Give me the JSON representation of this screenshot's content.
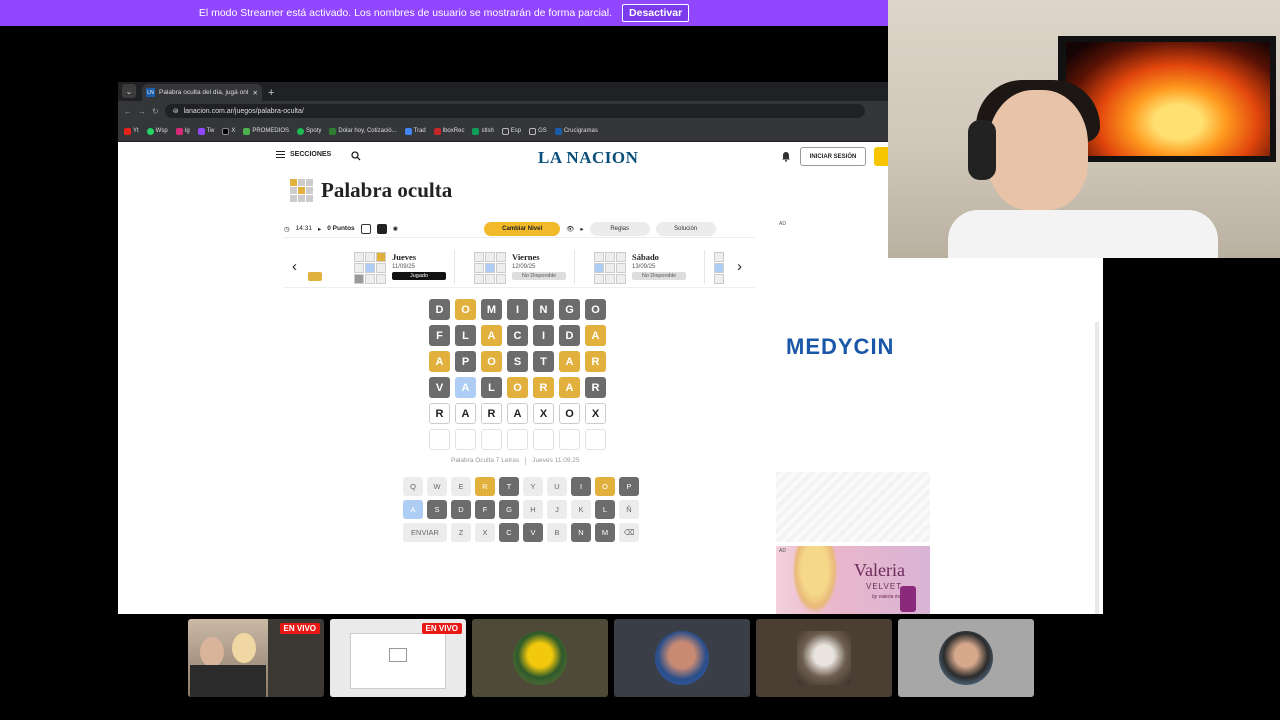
{
  "banner": {
    "text": "El modo Streamer está activado. Los nombres de usuario se mostrarán de forma parcial.",
    "button": "Desactivar"
  },
  "browser": {
    "tab_title": "Palabra oculta del día, jugá onl",
    "tab_favicon": "LN",
    "url": "lanacion.com.ar/juegos/palabra-oculta/",
    "bookmarks": [
      "Yt",
      "Wsp",
      "Ig",
      "Tw",
      "X",
      "PROMEDIOS",
      "Spoty",
      "Dolar hoy, Cotizació...",
      "Trad",
      "lboxRec",
      "stlsh",
      "Esp",
      "GS",
      "Crucigramas"
    ]
  },
  "site": {
    "sections": "SECCIONES",
    "logo": "LA NACION",
    "login": "INICIAR SESIÓN",
    "game_title": "Palabra oculta"
  },
  "toolbar": {
    "time": "14:31",
    "points": "0 Puntos",
    "level_button": "Cambiar Nivel",
    "rules": "Reglas",
    "solution": "Solución"
  },
  "days": [
    {
      "name": "Jueves",
      "date": "11/09/25",
      "status": "Jugado"
    },
    {
      "name": "Viernes",
      "date": "12/09/25",
      "status": "No Disponible"
    },
    {
      "name": "Sábado",
      "date": "13/09/25",
      "status": "No Disponible"
    }
  ],
  "board": [
    [
      [
        "D",
        "g"
      ],
      [
        "O",
        "y"
      ],
      [
        "M",
        "g"
      ],
      [
        "I",
        "g"
      ],
      [
        "N",
        "g"
      ],
      [
        "G",
        "g"
      ],
      [
        "O",
        "g"
      ]
    ],
    [
      [
        "F",
        "g"
      ],
      [
        "L",
        "g"
      ],
      [
        "A",
        "y"
      ],
      [
        "C",
        "g"
      ],
      [
        "I",
        "g"
      ],
      [
        "D",
        "g"
      ],
      [
        "A",
        "y"
      ]
    ],
    [
      [
        "A",
        "y"
      ],
      [
        "P",
        "g"
      ],
      [
        "O",
        "y"
      ],
      [
        "S",
        "g"
      ],
      [
        "T",
        "g"
      ],
      [
        "A",
        "y"
      ],
      [
        "R",
        "y"
      ]
    ],
    [
      [
        "V",
        "g"
      ],
      [
        "A",
        "b"
      ],
      [
        "L",
        "g"
      ],
      [
        "O",
        "y"
      ],
      [
        "R",
        "y"
      ],
      [
        "A",
        "y"
      ],
      [
        "R",
        "g"
      ]
    ],
    [
      [
        "R",
        "w"
      ],
      [
        "A",
        "w"
      ],
      [
        "R",
        "w"
      ],
      [
        "A",
        "w"
      ],
      [
        "X",
        "w"
      ],
      [
        "O",
        "w"
      ],
      [
        "X",
        "w"
      ]
    ],
    [
      [
        "",
        "e"
      ],
      [
        "",
        "e"
      ],
      [
        "",
        "e"
      ],
      [
        "",
        "e"
      ],
      [
        "",
        "e"
      ],
      [
        "",
        "e"
      ],
      [
        "",
        "e"
      ]
    ]
  ],
  "caption": {
    "left": "Palabra Oculta 7 Letras",
    "right": "Jueves 11.09.25"
  },
  "keyboard": [
    [
      [
        "Q",
        ""
      ],
      [
        "W",
        ""
      ],
      [
        "E",
        ""
      ],
      [
        "R",
        "y"
      ],
      [
        "T",
        "g"
      ],
      [
        "Y",
        ""
      ],
      [
        "U",
        ""
      ],
      [
        "I",
        "g"
      ],
      [
        "O",
        "y"
      ],
      [
        "P",
        "g"
      ]
    ],
    [
      [
        "A",
        "b"
      ],
      [
        "S",
        "g"
      ],
      [
        "D",
        "g"
      ],
      [
        "F",
        "g"
      ],
      [
        "G",
        "g"
      ],
      [
        "H",
        ""
      ],
      [
        "J",
        ""
      ],
      [
        "K",
        ""
      ],
      [
        "L",
        "g"
      ],
      [
        "Ñ",
        ""
      ]
    ],
    [
      [
        "ENVIAR",
        "wide"
      ],
      [
        "Z",
        ""
      ],
      [
        "X",
        ""
      ],
      [
        "C",
        "g"
      ],
      [
        "V",
        "g"
      ],
      [
        "B",
        ""
      ],
      [
        "N",
        "g"
      ],
      [
        "M",
        "g"
      ],
      [
        "⌫",
        ""
      ]
    ]
  ],
  "ads": {
    "ad_label": "AD",
    "medycin": "MEDYCIN",
    "valeria": "Valeria",
    "velvet": "VELVET",
    "by": "by valeria mazza"
  },
  "participants": [
    {
      "live": "EN VIVO"
    },
    {
      "live": "EN VIVO"
    },
    {
      "live": ""
    },
    {
      "live": ""
    },
    {
      "live": ""
    },
    {
      "live": ""
    }
  ],
  "colors": {
    "streamer_purple": "#9146ff",
    "tile_gray": "#6c6c6c",
    "tile_yellow": "#e2b03c",
    "tile_blue": "#aecdf5",
    "live_red": "#e91916",
    "logo_blue": "#0a4e7a"
  }
}
